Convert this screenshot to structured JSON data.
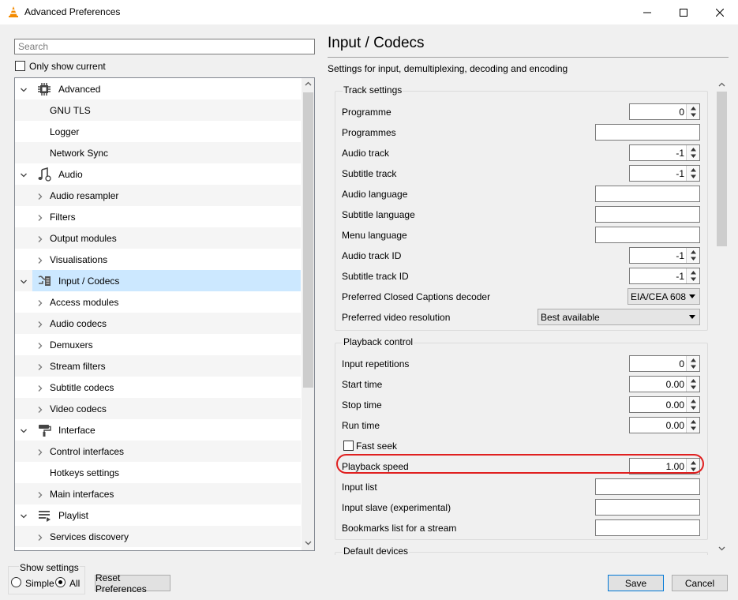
{
  "window": {
    "title": "Advanced Preferences"
  },
  "search": {
    "placeholder": "Search"
  },
  "only_show_current": "Only show current",
  "tree": [
    {
      "label": "Advanced",
      "level": 0,
      "expanded": true,
      "icon": "cpu-icon"
    },
    {
      "label": "GNU TLS",
      "level": 1
    },
    {
      "label": "Logger",
      "level": 1
    },
    {
      "label": "Network Sync",
      "level": 1
    },
    {
      "label": "Audio",
      "level": 0,
      "expanded": true,
      "icon": "music-note-icon"
    },
    {
      "label": "Audio resampler",
      "level": 1,
      "has_children": true
    },
    {
      "label": "Filters",
      "level": 1,
      "has_children": true
    },
    {
      "label": "Output modules",
      "level": 1,
      "has_children": true
    },
    {
      "label": "Visualisations",
      "level": 1,
      "has_children": true
    },
    {
      "label": "Input / Codecs",
      "level": 0,
      "expanded": true,
      "selected": true,
      "icon": "codec-icon"
    },
    {
      "label": "Access modules",
      "level": 1,
      "has_children": true
    },
    {
      "label": "Audio codecs",
      "level": 1,
      "has_children": true
    },
    {
      "label": "Demuxers",
      "level": 1,
      "has_children": true
    },
    {
      "label": "Stream filters",
      "level": 1,
      "has_children": true
    },
    {
      "label": "Subtitle codecs",
      "level": 1,
      "has_children": true
    },
    {
      "label": "Video codecs",
      "level": 1,
      "has_children": true
    },
    {
      "label": "Interface",
      "level": 0,
      "expanded": true,
      "icon": "paint-roller-icon"
    },
    {
      "label": "Control interfaces",
      "level": 1,
      "has_children": true
    },
    {
      "label": "Hotkeys settings",
      "level": 1
    },
    {
      "label": "Main interfaces",
      "level": 1,
      "has_children": true
    },
    {
      "label": "Playlist",
      "level": 0,
      "expanded": true,
      "icon": "playlist-icon"
    },
    {
      "label": "Services discovery",
      "level": 1,
      "has_children": true
    }
  ],
  "section": {
    "title": "Input / Codecs",
    "description": "Settings for input, demultiplexing, decoding and encoding"
  },
  "track_settings": {
    "title": "Track settings",
    "fields": [
      {
        "label": "Programme",
        "type": "spin",
        "value": "0"
      },
      {
        "label": "Programmes",
        "type": "text",
        "value": ""
      },
      {
        "label": "Audio track",
        "type": "spin",
        "value": "-1"
      },
      {
        "label": "Subtitle track",
        "type": "spin",
        "value": "-1"
      },
      {
        "label": "Audio language",
        "type": "text",
        "value": ""
      },
      {
        "label": "Subtitle language",
        "type": "text",
        "value": ""
      },
      {
        "label": "Menu language",
        "type": "text",
        "value": ""
      },
      {
        "label": "Audio track ID",
        "type": "spin",
        "value": "-1"
      },
      {
        "label": "Subtitle track ID",
        "type": "spin",
        "value": "-1"
      },
      {
        "label": "Preferred Closed Captions decoder",
        "type": "combo",
        "value": "EIA/CEA 608"
      },
      {
        "label": "Preferred video resolution",
        "type": "combo",
        "value": "Best available"
      }
    ]
  },
  "playback_control": {
    "title": "Playback control",
    "fields": [
      {
        "label": "Input repetitions",
        "type": "spin",
        "value": "0"
      },
      {
        "label": "Start time",
        "type": "spin",
        "value": "0.00"
      },
      {
        "label": "Stop time",
        "type": "spin",
        "value": "0.00"
      },
      {
        "label": "Run time",
        "type": "spin",
        "value": "0.00"
      },
      {
        "label": "Fast seek",
        "type": "checkbox",
        "value": ""
      },
      {
        "label": "Playback speed",
        "type": "spin",
        "value": "1.00"
      },
      {
        "label": "Input list",
        "type": "text",
        "value": ""
      },
      {
        "label": "Input slave (experimental)",
        "type": "text",
        "value": ""
      },
      {
        "label": "Bookmarks list for a stream",
        "type": "text",
        "value": ""
      }
    ]
  },
  "default_devices": {
    "title": "Default devices"
  },
  "show_settings": {
    "title": "Show settings",
    "simple": "Simple",
    "all": "All",
    "selected": "All"
  },
  "buttons": {
    "reset": "Reset Preferences",
    "save": "Save",
    "cancel": "Cancel"
  },
  "colors": {
    "selection": "#cce8ff",
    "highlight_ring": "#e02020",
    "accent": "#0078d7"
  }
}
